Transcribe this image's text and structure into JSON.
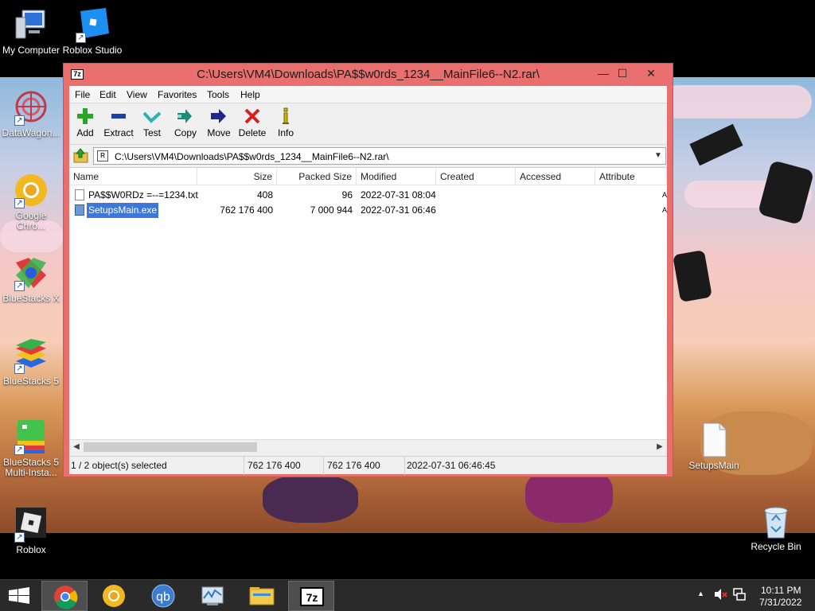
{
  "desktop": {
    "icons": [
      {
        "label": "My Computer"
      },
      {
        "label": "Roblox Studio"
      },
      {
        "label": "DataWagon..."
      },
      {
        "label": "Google Chro..."
      },
      {
        "label": "BlueStacks X"
      },
      {
        "label": "BlueStacks 5"
      },
      {
        "label": "BlueStacks 5 Multi-Insta..."
      },
      {
        "label": "Roblox"
      },
      {
        "label": "SetupsMain"
      },
      {
        "label": "Recycle Bin"
      }
    ]
  },
  "window": {
    "app_icon": "7z",
    "title": "C:\\Users\\VM4\\Downloads\\PA$$w0rds_1234__MainFile6--N2.rar\\",
    "controls": {
      "minimize": "—",
      "maximize": "☐",
      "close": "✕"
    },
    "menu": [
      "File",
      "Edit",
      "View",
      "Favorites",
      "Tools",
      "Help"
    ],
    "toolbar": [
      {
        "label": "Add",
        "icon": "plus-icon",
        "color": "#2aa52a"
      },
      {
        "label": "Extract",
        "icon": "minus-icon",
        "color": "#1d3fa8"
      },
      {
        "label": "Test",
        "icon": "checkmark-icon",
        "color": "#2bb3b3"
      },
      {
        "label": "Copy",
        "icon": "double-arrow-icon",
        "color": "#1c8c7a"
      },
      {
        "label": "Move",
        "icon": "arrow-right-icon",
        "color": "#1d2a8c"
      },
      {
        "label": "Delete",
        "icon": "x-icon",
        "color": "#d42020"
      },
      {
        "label": "Info",
        "icon": "info-icon",
        "color": "#c9b400"
      }
    ],
    "address": "C:\\Users\\VM4\\Downloads\\PA$$w0rds_1234__MainFile6--N2.rar\\",
    "columns": [
      "Name",
      "Size",
      "Packed Size",
      "Modified",
      "Created",
      "Accessed",
      "Attribute"
    ],
    "files": [
      {
        "name": "PA$$W0RDz =--=1234.txt",
        "size": "408",
        "packed": "96",
        "modified": "2022-07-31 08:04",
        "attr": "A",
        "selected": false
      },
      {
        "name": "SetupsMain.exe",
        "size": "762 176 400",
        "packed": "7 000 944",
        "modified": "2022-07-31 06:46",
        "attr": "A",
        "selected": true
      }
    ],
    "status": {
      "selection": "1 / 2 object(s) selected",
      "size": "762 176 400",
      "packed": "762 176 400",
      "modified": "2022-07-31 06:46:45"
    }
  },
  "taskbar": {
    "apps": [
      "start-button",
      "chrome",
      "chrome-canary",
      "qbittorrent",
      "task-manager",
      "file-explorer",
      "7zip"
    ],
    "qbittorrent_label": "qb",
    "sevenzip_label": "7z",
    "clock": {
      "time": "10:11 PM",
      "date": "7/31/2022"
    }
  }
}
